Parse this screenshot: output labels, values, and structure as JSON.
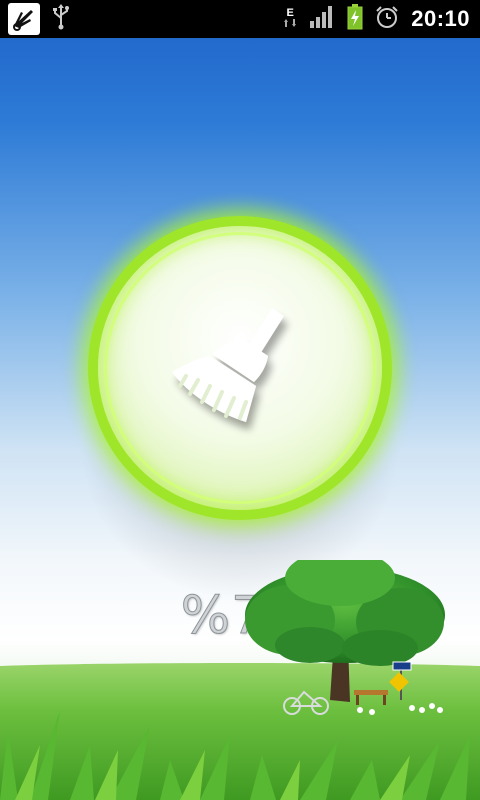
{
  "status_bar": {
    "notifications": [
      "app-icon",
      "usb-icon"
    ],
    "network_type": "E",
    "signal_icon": "signal-bars-icon",
    "battery_icon": "battery-charging-icon",
    "alarm_icon": "alarm-clock-icon",
    "time": "20:10"
  },
  "main": {
    "clean_button_icon": "broom-icon",
    "percentage": "%76"
  },
  "colors": {
    "accent_green": "#9fe62a",
    "sky_blue": "#1f63c9",
    "grass_green": "#5fb53a"
  }
}
